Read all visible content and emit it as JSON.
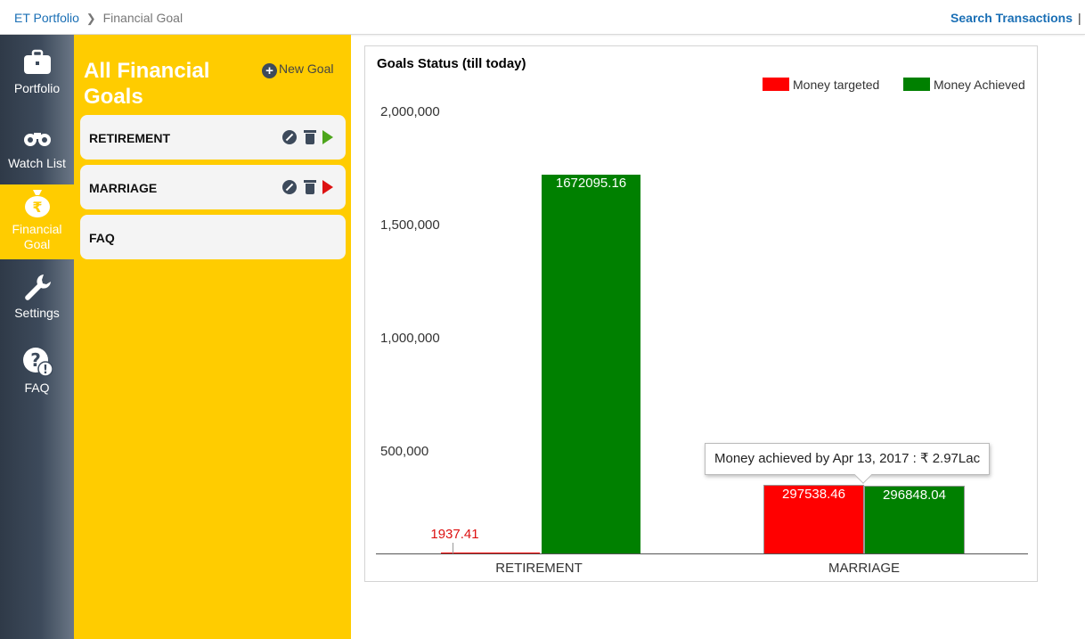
{
  "breadcrumb": {
    "root": "ET Portfolio",
    "current": "Financial Goal"
  },
  "header": {
    "search_label": "Search Transactions",
    "divider": "|"
  },
  "sidebar": {
    "items": [
      {
        "label": "Portfolio",
        "icon": "briefcase-icon"
      },
      {
        "label": "Watch List",
        "icon": "binoculars-icon"
      },
      {
        "label": "Financial Goal",
        "icon": "money-bag-icon",
        "active": true
      },
      {
        "label": "Settings",
        "icon": "wrench-icon"
      },
      {
        "label": "FAQ",
        "icon": "question-alert-icon"
      }
    ]
  },
  "goals_panel": {
    "title": "All Financial Goals",
    "new_goal_label": "New Goal",
    "goals": [
      {
        "name": "RETIREMENT",
        "status_color": "#4da51b"
      },
      {
        "name": "MARRIAGE",
        "status_color": "#dd1111"
      },
      {
        "name": "FAQ"
      }
    ]
  },
  "colors": {
    "accent_yellow": "#ffcc00",
    "link_blue": "#1a6fb5",
    "rail_dark": "#2f3a48"
  },
  "chart": {
    "tooltip": "Money achieved by Apr 13, 2017 : ₹ 2.97Lac"
  },
  "chart_data": {
    "type": "bar",
    "title": "Goals Status (till today)",
    "categories": [
      "RETIREMENT",
      "MARRIAGE"
    ],
    "series": [
      {
        "name": "Money targeted",
        "color": "#ff0000",
        "values": [
          1937.41,
          297538.46
        ],
        "labels": [
          "1937.41",
          "297538.46"
        ]
      },
      {
        "name": "Money Achieved",
        "color": "#008000",
        "values": [
          1672095.16,
          296848.04
        ],
        "labels": [
          "1672095.16",
          "296848.04"
        ]
      }
    ],
    "yticks": [
      "500,000",
      "1,000,000",
      "1,500,000",
      "2,000,000"
    ],
    "ylim": [
      0,
      2000000
    ],
    "legend_position": "top-right",
    "grid": false
  }
}
